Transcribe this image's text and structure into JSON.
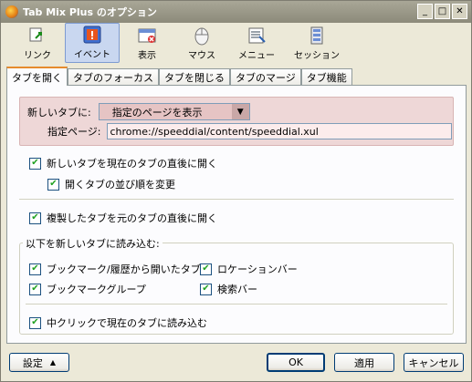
{
  "window": {
    "title": "Tab Mix Plus のオプション",
    "minimize": "_",
    "maximize": "□",
    "close": "✕"
  },
  "toolbar": [
    {
      "label": "リンク",
      "icon": "link-icon"
    },
    {
      "label": "イベント",
      "icon": "event-icon"
    },
    {
      "label": "表示",
      "icon": "display-icon"
    },
    {
      "label": "マウス",
      "icon": "mouse-icon"
    },
    {
      "label": "メニュー",
      "icon": "menu-icon"
    },
    {
      "label": "セッション",
      "icon": "session-icon"
    }
  ],
  "tabs": [
    "タブを開く",
    "タブのフォーカス",
    "タブを閉じる",
    "タブのマージ",
    "タブ機能"
  ],
  "newtab": {
    "label": "新しいタブに:",
    "selected": "指定のページを表示",
    "page_label": "指定ページ:",
    "page_value": "chrome://speeddial/content/speeddial.xul"
  },
  "options": {
    "open_after_current": "新しいタブを現在のタブの直後に開く",
    "change_order": "開くタブの並び順を変更",
    "duplicate_after": "複製したタブを元のタブの直後に開く"
  },
  "load_group": {
    "legend": "以下を新しいタブに読み込む:",
    "bookmarks_history": "ブックマーク/履歴から開いたタブ",
    "location_bar": "ロケーションバー",
    "bookmark_group": "ブックマークグループ",
    "search_bar": "検索バー",
    "middle_click": "中クリックで現在のタブに読み込む"
  },
  "buttons": {
    "settings": "設定",
    "ok": "OK",
    "apply": "適用",
    "cancel": "キャンセル"
  },
  "colors": {
    "active_tab_accent": "#e68b2c",
    "newtab_bg": "#eed7d7",
    "check": "#21a121"
  }
}
